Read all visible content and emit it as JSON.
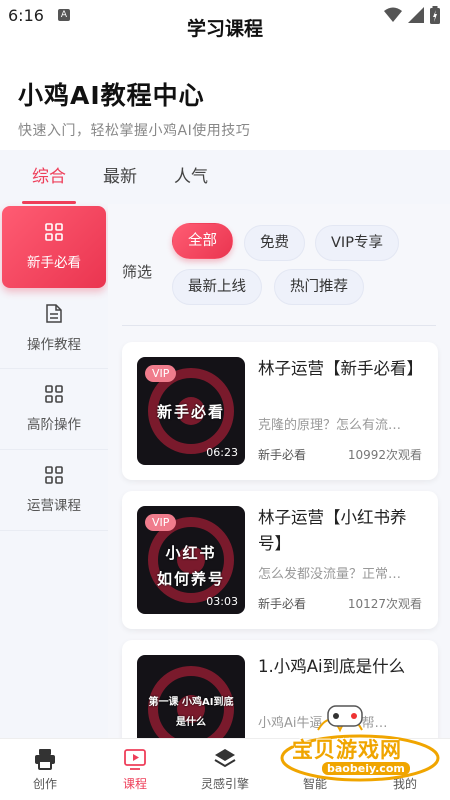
{
  "status_bar": {
    "time": "6:16",
    "notification_glyph": "A"
  },
  "header": {
    "title": "学习课程"
  },
  "hero": {
    "title": "小鸡AI教程中心",
    "subtitle": "快速入门，轻松掌握小鸡AI使用技巧"
  },
  "tabs": [
    {
      "label": "综合",
      "active": true
    },
    {
      "label": "最新",
      "active": false
    },
    {
      "label": "人气",
      "active": false
    }
  ],
  "sidebar": {
    "items": [
      {
        "label": "新手必看",
        "icon": "grid-icon",
        "active": true
      },
      {
        "label": "操作教程",
        "icon": "document-icon",
        "active": false
      },
      {
        "label": "高阶操作",
        "icon": "grid-icon",
        "active": false
      },
      {
        "label": "运营课程",
        "icon": "grid-icon",
        "active": false
      }
    ]
  },
  "filter": {
    "label": "筛选",
    "chips": [
      {
        "label": "全部",
        "active": true
      },
      {
        "label": "免费",
        "active": false
      },
      {
        "label": "VIP专享",
        "active": false
      },
      {
        "label": "最新上线",
        "active": false
      },
      {
        "label": "热门推荐",
        "active": false
      }
    ]
  },
  "courses": [
    {
      "vip": "VIP",
      "thumb_title": "新手必看",
      "duration": "06:23",
      "title": "林子运营【新手必看】",
      "desc": "克隆的原理？怎么有流…",
      "tag": "新手必看",
      "views": "10992次观看"
    },
    {
      "vip": "VIP",
      "thumb_title": "小红书 如何养号",
      "duration": "03:03",
      "title": "林子运营【小红书养号】",
      "desc": "怎么发都没流量？正常…",
      "tag": "新手必看",
      "views": "10127次观看"
    },
    {
      "vip": "",
      "thumb_title": "第一课 小鸡AI到底是什么",
      "duration": "",
      "title": "1.小鸡Ai到底是什么",
      "desc": "小鸡Ai牛逼…，能帮…",
      "tag": "",
      "views": ""
    }
  ],
  "bottom_nav": [
    {
      "label": "创作",
      "icon": "printer-icon",
      "active": false
    },
    {
      "label": "课程",
      "icon": "video-icon",
      "active": true
    },
    {
      "label": "灵感引擎",
      "icon": "layers-icon",
      "active": false
    },
    {
      "label": "智能",
      "icon": "smart-icon",
      "active": false
    },
    {
      "label": "我的",
      "icon": "user-icon",
      "active": false
    }
  ],
  "watermark": {
    "text": "宝贝游戏网",
    "url": "baobeiy.com"
  },
  "colors": {
    "accent": "#ee3f5a",
    "muted": "#f4f6fb",
    "watermark": "#f0a500"
  }
}
